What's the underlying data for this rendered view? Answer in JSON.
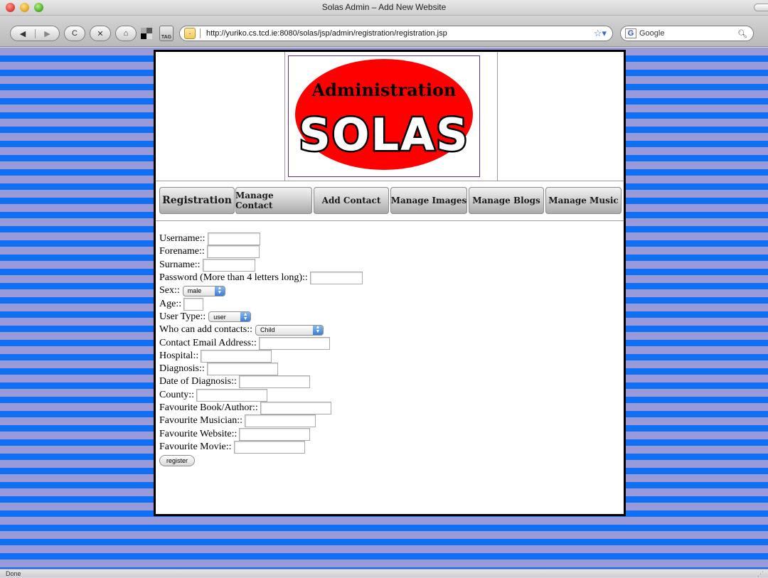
{
  "window": {
    "title": "Solas Admin – Add New Website"
  },
  "toolbar": {
    "back_glyph": "◀",
    "forward_glyph": "▶",
    "reload_glyph": "C",
    "stop_glyph": "✕",
    "home_glyph": "⌂",
    "tag_label": "TAG",
    "url": "http://yuriko.cs.tcd.ie:8080/solas/jsp/admin/registration/registration.jsp",
    "search_engine": "Google",
    "search_engine_badge": "G"
  },
  "logo": {
    "top_text": "Administration",
    "main_text": "SOLAS",
    "bg_color": "#ff0000",
    "text_color": "#000000"
  },
  "nav": [
    {
      "label": "Registration"
    },
    {
      "label": "Manage Contact"
    },
    {
      "label": "Add Contact"
    },
    {
      "label": "Manage Images"
    },
    {
      "label": "Manage Blogs"
    },
    {
      "label": "Manage Music"
    }
  ],
  "form": {
    "username": "Username::",
    "forename": "Forename::",
    "surname": "Surname::",
    "password": "Password (More than 4 letters long)::",
    "sex": "Sex::",
    "sex_value": "male",
    "age": "Age::",
    "user_type": "User Type::",
    "user_type_value": "user",
    "who_can_add": "Who can add contacts::",
    "who_can_add_value": "Child",
    "contact_email": "Contact Email Address::",
    "hospital": "Hospital::",
    "diagnosis": "Diagnosis::",
    "date_of_diagnosis": "Date of Diagnosis::",
    "county": "County::",
    "fav_book": "Favourite Book/Author::",
    "fav_musician": "Favourite Musician::",
    "fav_website": "Favourite Website::",
    "fav_movie": "Favourite Movie::",
    "register_label": "register"
  },
  "status": {
    "text": "Done"
  },
  "colors": {
    "stripe_light": "#9a9ad8",
    "stripe_dark": "#0f6ff5",
    "logo_red": "#ff0000",
    "frame_border": "#000000"
  }
}
